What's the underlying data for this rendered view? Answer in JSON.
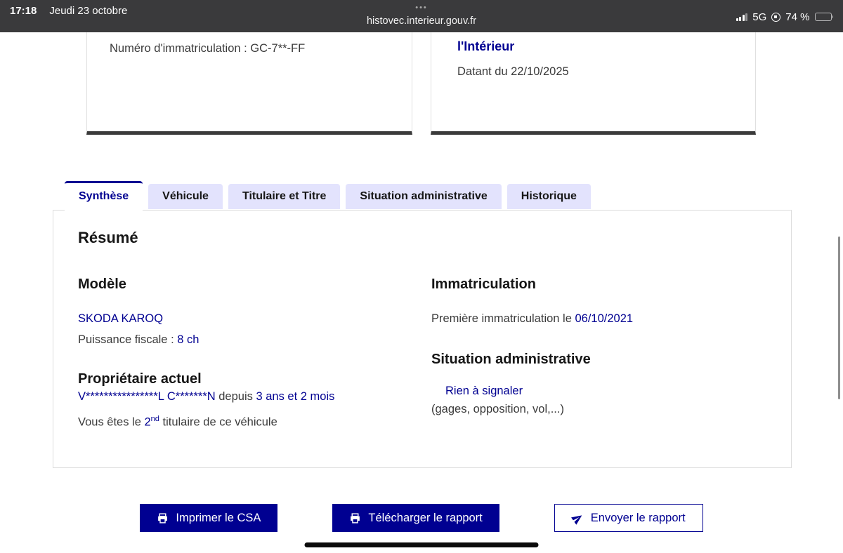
{
  "status_bar": {
    "time": "17:18",
    "date": "Jeudi 23 octobre",
    "dots": "•••",
    "url": "histovec.interieur.gouv.fr",
    "network": "5G",
    "battery_text": "74 %",
    "battery_level_percent": 74,
    "icons": [
      "signal-bars-icon",
      "rotation-lock-icon",
      "battery-icon"
    ]
  },
  "cards": {
    "left": {
      "text": "Numéro d'immatriculation : GC-7**-FF"
    },
    "right": {
      "title": "l'Intérieur",
      "subtitle": "Datant du 22/10/2025"
    }
  },
  "tabs": [
    {
      "label": "Synthèse",
      "active": true
    },
    {
      "label": "Véhicule",
      "active": false
    },
    {
      "label": "Titulaire et Titre",
      "active": false
    },
    {
      "label": "Situation administrative",
      "active": false
    },
    {
      "label": "Historique",
      "active": false
    }
  ],
  "panel": {
    "title": "Résumé",
    "model": {
      "heading": "Modèle",
      "value": "SKODA KAROQ",
      "fiscal_label": "Puissance fiscale : ",
      "fiscal_value": "8 ch"
    },
    "owner": {
      "heading": "Propriétaire actuel",
      "masked_name": "V****************L C*******N",
      "depuis": " depuis ",
      "duration": "3 ans et 2 mois",
      "line2_prefix": "Vous êtes le ",
      "ordinal_number": "2",
      "ordinal_suffix": "nd",
      "line2_suffix": " titulaire de ce véhicule"
    },
    "immatriculation": {
      "heading": "Immatriculation",
      "label": "Première immatriculation le ",
      "date": "06/10/2021"
    },
    "situation": {
      "heading": "Situation administrative",
      "status": "Rien à signaler",
      "note": "(gages, opposition, vol,...)"
    }
  },
  "actions": {
    "print_label": "Imprimer le CSA",
    "download_label": "Télécharger le rapport",
    "send_label": "Envoyer le rapport",
    "icons": [
      "printer-icon",
      "printer-icon",
      "send-plane-icon"
    ]
  },
  "colors": {
    "accent_blue": "#000091",
    "tab_inactive_bg": "#e3e3fd",
    "status_bar_bg": "#3a3a3c",
    "body_text": "#3a3a3a",
    "heading_text": "#161616",
    "card_bottom_bar": "#3a3a3a"
  }
}
